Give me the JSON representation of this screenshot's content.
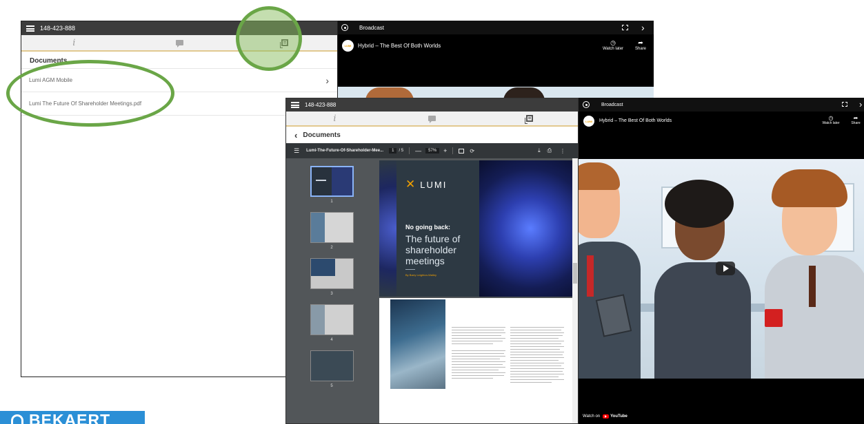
{
  "window1": {
    "meeting_id": "148-423-888",
    "section_title": "Documents",
    "documents": [
      {
        "name": "Lumi AGM Mobile",
        "chevron": "›"
      },
      {
        "name": "Lumi The Future Of Shareholder Meetings.pdf"
      }
    ],
    "tabs": [
      {
        "icon": "info-icon",
        "glyph": "i"
      },
      {
        "icon": "chat-icon"
      },
      {
        "icon": "documents-icon",
        "active": true
      }
    ]
  },
  "broadcast1": {
    "header": "Broadcast",
    "chevron": "›",
    "video_title": "Hybrid – The Best Of Both Worlds",
    "channel_logo": "LUMI",
    "watch_later": "Watch later",
    "share": "Share"
  },
  "window2": {
    "meeting_id": "148-423-888",
    "back_label": "Documents",
    "pdf": {
      "filename": "Lumi-The-Future-Of-Shareholder-Mee...",
      "page_current": "1",
      "page_total": "/ 5",
      "zoom": "57%",
      "thumbnails": [
        "1",
        "2",
        "3",
        "4",
        "5"
      ],
      "cover": {
        "brand": "LUMI",
        "kicker": "No going back:",
        "title_line1": "The future of",
        "title_line2": "shareholder",
        "title_line3": "meetings",
        "byline": "By Barry Leighton-Walley"
      }
    }
  },
  "broadcast2": {
    "header": "Broadcast",
    "video_title": "Hybrid – The Best Of Both Worlds",
    "channel_logo": "LUMI",
    "watch_later": "Watch later",
    "share": "Share",
    "watch_on": "Watch on",
    "youtube": "YouTube"
  },
  "footer_logo": {
    "text": "BEKAERT"
  },
  "colors": {
    "topbar": "#3c3c3c",
    "tab_accent": "#e2c98f",
    "highlight_ring": "#6aa647",
    "lumi_orange": "#f0a000",
    "bekaert_blue": "#2b8fd6"
  }
}
